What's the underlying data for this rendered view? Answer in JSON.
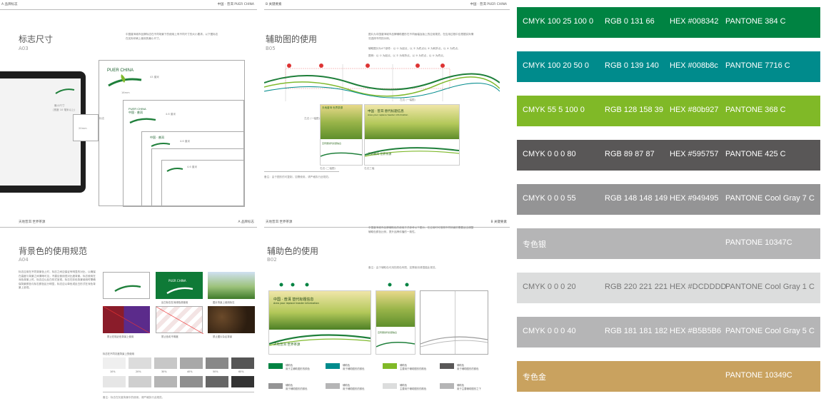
{
  "pages": {
    "p1": {
      "header_left": "A 品牌标志",
      "header_right": "中国 · 普洱   PUER CHINA",
      "title": "标志尺寸",
      "code": "A03",
      "para": "中国普洱城市品牌标志在不同场景下的使用上有不同尺寸的大小要求。以下图标志在实际印刷上使用的最小尺寸。",
      "logo_en": "PUER CHINA",
      "logo_cn": "中国 · 普洱",
      "sizes": [
        "43 厘米",
        "4.6 厘米",
        "4.6 厘米",
        "4.6 厘米"
      ],
      "size_small": "16mm",
      "notes": [
        "最小尺寸",
        "(宽度 10 毫米以上)"
      ],
      "mini_label": "标志",
      "mini_size": "20mm",
      "bottom_sizes": [
        "24mm",
        "20mm",
        "20mm",
        "24mm"
      ]
    },
    "p2": {
      "header_left": "B 关键要素",
      "header_right": "中国 · 普洱   PUER CHINA",
      "title": "辅助图的使用",
      "code": "B05",
      "para": "图片为中国普洱城市品牌辅助图形在不同画幅及版上的应用规范，在应用过程中应根据实际情况选择不同的示例。",
      "steps": [
        "辅助图分为4个部件：以 ① 为起点，以 ② 为终点以 ③ 为转折点，以 ④ 为终点，",
        "图例：以 ① 为起点，以 ② 为转折点，以 ③ 为终点，以 ④ 为终点，"
      ],
      "labels": [
        "左边 (一幅图)",
        "左边 (一幅图)",
        "右边 (二幅图)",
        "右边三幅"
      ],
      "card_title": "中国 · 普洱 替代标题信息",
      "card_sub": "Area your replace header information",
      "card_slogan": "天地普洱 世界茶源",
      "card_small": "宣传册替代标题信息",
      "card_small_en": "This is how we replace the headline information",
      "note": "备注：由于图形的可复制，如需使用，请严格执行此规范。"
    },
    "p3": {
      "header_left": "天地普洱  世界茶源",
      "header_right": "A 品牌标志",
      "title": "背景色的使用规范",
      "code": "A04",
      "para": "标志应用在不同背景色上时，标志之间应保证有明显的对比，以确保在高度与背景之间清晰可见，不建议使用低对比度背景。标志使用在深色背景上时，标志应以反白形式呈现。标志在彩色背景使用时需确保背景颜色与标志颜色区分明显，标志应以单色或反白形式在深色背景上呈现。",
      "captions": [
        "反白标志在深绿色底使用",
        "图片背景上使用标志",
        "禁止在杂乱背景使用",
        "禁止在相近色背景上使用",
        "禁止色彩不明度",
        "禁止图片杂乱背景"
      ],
      "gray_label": "标志在不同灰度背景上的使用",
      "gray_values": [
        "10%",
        "20%",
        "30%",
        "40%",
        "50%",
        "60%"
      ],
      "note": "备注：标志在灰度背景中的使用，请严格执行此规范。"
    },
    "p4": {
      "header_left": "天地普洱  世界茶源",
      "header_right": "B 关键要素",
      "title": "辅助色的使用",
      "code": "B02",
      "para": "中国普洱城市品牌辅助色的使用方式参考以下图示，在应用时可按照不同场景的需要适当调整辅助色颜色比例，提升品牌传播的一致性。",
      "note": "备注：由于辅助色可用的颜色有限，如需使用请遵循此规范。",
      "card_title": "中国 · 普洱 替代标题信息",
      "card_sub": "Area your replace header information",
      "card_slogan": "天地普洱 世界茶源",
      "card_small": "宣传册替代标题信息",
      "color_labels": [
        "辅助色",
        "辅助色",
        "辅助色",
        "辅助色",
        "辅助色",
        "辅助色",
        "辅助色",
        "辅助色"
      ],
      "color_descs": [
        "用于主辅助图形的颜色",
        "用于辅助图形的颜色",
        "主要用于辅助图形的颜色",
        "用于辅助图形的颜色",
        "用于辅助图形的颜色",
        "用于辅助图形的颜色",
        "主要用于辅助图形的颜色",
        "用于主要辅助图形之下"
      ]
    }
  },
  "swatches": [
    {
      "cmyk": "CMYK  100 25 100 0",
      "rgb": "RGB  0 131 66",
      "hex": "HEX  #008342",
      "pantone": "PANTONE   384 C",
      "color": "#008342"
    },
    {
      "cmyk": "CMYK 100 20 50 0",
      "rgb": "RGB  0 139 140",
      "hex": "HEX  #008b8c",
      "pantone": "PANTONE   7716 C",
      "color": "#008b8c"
    },
    {
      "cmyk": "CMYK  55 5 100 0",
      "rgb": "RGB  128 158 39",
      "hex": "HEX  #80b927",
      "pantone": "PANTONE   368 C",
      "color": "#80b927"
    },
    {
      "cmyk": "CMYK 0 0 0 80",
      "rgb": "RGB  89 87 87",
      "hex": "HEX  #595757",
      "pantone": "PANTONE   425 C",
      "color": "#595757"
    },
    {
      "cmyk": "CMYK 0 0 0 55",
      "rgb": "RGB  148 148 149",
      "hex": "HEX  #949495",
      "pantone": "PANTONE   Cool Gray 7 C",
      "color": "#949495"
    },
    {
      "cmyk": "专色银",
      "rgb": "",
      "hex": "",
      "pantone": "PANTONE   10347C",
      "color": "#b5b5b6"
    },
    {
      "cmyk": "CMYK 0 0 0 20",
      "rgb": "RGB  220 221 221",
      "hex": "HEX  #DCDDDD",
      "pantone": "PANTONE   Cool Gray 1 C",
      "color": "#dcdddd"
    },
    {
      "cmyk": "CMYK 0 0 0 40",
      "rgb": "RGB  181 181 182",
      "hex": "HEX  #B5B5B6",
      "pantone": "PANTONE   Cool Gray 5 C",
      "color": "#b5b5b6"
    },
    {
      "cmyk": "专色金",
      "rgb": "",
      "hex": "",
      "pantone": "PANTONE   10349C",
      "color": "#c9a25f"
    }
  ],
  "legend_colors": [
    "#008342",
    "#008b8c",
    "#80b927",
    "#595757",
    "#949495",
    "#b5b5b6",
    "#dcdddd",
    "#b5b5b6"
  ]
}
